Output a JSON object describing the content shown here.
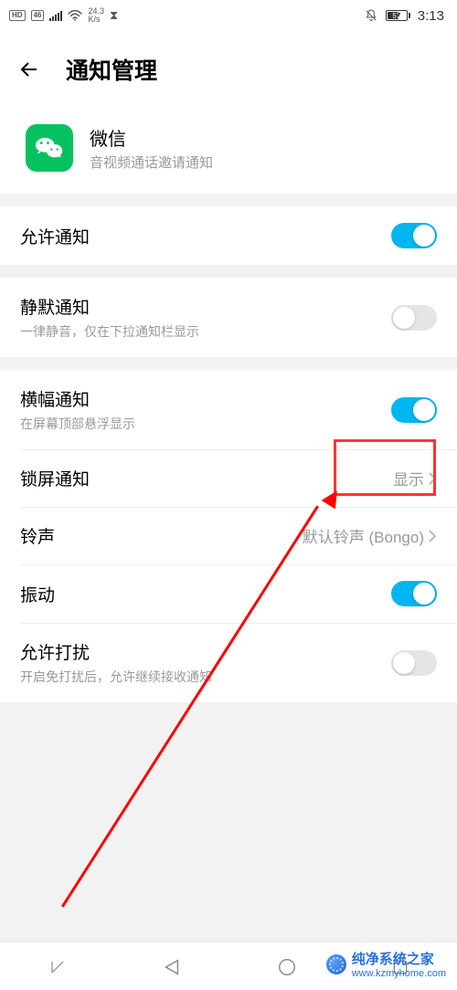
{
  "status": {
    "hd_badge": "HD",
    "net_badge": "46",
    "speed": "24.3\nK/s",
    "battery_text": "57",
    "time": "3:13"
  },
  "header": {
    "title": "通知管理"
  },
  "app": {
    "name": "微信",
    "subtitle": "音视频通话邀请通知"
  },
  "rows": {
    "allow": {
      "label": "允许通知"
    },
    "silent": {
      "label": "静默通知",
      "desc": "一律静音，仅在下拉通知栏显示"
    },
    "banner": {
      "label": "横幅通知",
      "desc": "在屏幕顶部悬浮显示"
    },
    "lockscreen": {
      "label": "锁屏通知",
      "value": "显示"
    },
    "ringtone": {
      "label": "铃声",
      "value": "默认铃声 (Bongo)"
    },
    "vibrate": {
      "label": "振动"
    },
    "disturb": {
      "label": "允许打扰",
      "desc": "开启免打扰后，允许继续接收通知"
    }
  },
  "watermark": {
    "name": "纯净系统之家",
    "url": "www.kzmyhome.com"
  }
}
